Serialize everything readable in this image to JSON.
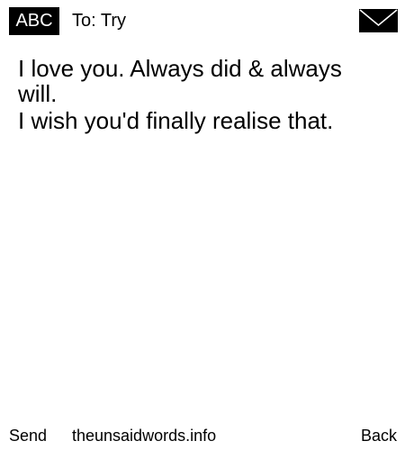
{
  "header": {
    "badge_label": "ABC",
    "to_text": "To: Try",
    "mail_icon": "envelope-icon"
  },
  "message": {
    "lines": [
      "I love you. Always did & always",
      "will.",
      "I wish you'd finally realise that."
    ]
  },
  "footer": {
    "send_label": "Send",
    "site_label": "theunsaidwords.info",
    "back_label": "Back"
  },
  "colors": {
    "background": "#ffffff",
    "text": "#000000",
    "badge_bg": "#000000",
    "badge_text": "#ffffff"
  }
}
